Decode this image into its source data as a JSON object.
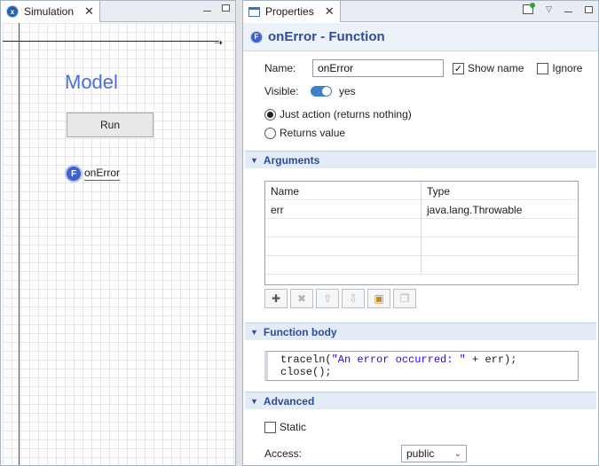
{
  "simulation": {
    "tab_label": "Simulation",
    "model_title": "Model",
    "run_button": "Run",
    "function_item": "onError"
  },
  "properties": {
    "tab_label": "Properties",
    "title": "onError - Function",
    "name_label": "Name:",
    "name_value": "onError",
    "show_name_label": "Show name",
    "show_name_checked": true,
    "ignore_label": "Ignore",
    "visible_label": "Visible:",
    "visible_value": "yes",
    "radio_just_action": "Just action (returns nothing)",
    "radio_returns_value": "Returns value",
    "arguments_section": "Arguments",
    "args_columns": [
      "Name",
      "Type"
    ],
    "args_rows": [
      {
        "name": "err",
        "type": "java.lang.Throwable"
      }
    ],
    "function_body_section": "Function body",
    "code_line1_a": "traceln(",
    "code_line1_str": "\"An error occurred: \"",
    "code_line1_b": " + err);",
    "code_line2": "close();",
    "advanced_section": "Advanced",
    "static_label": "Static",
    "access_label": "Access:",
    "access_value": "public"
  },
  "colors": {
    "accent": "#2d4c9a",
    "model_title": "#4a6fd6",
    "function_icon": "#3f63c8"
  }
}
